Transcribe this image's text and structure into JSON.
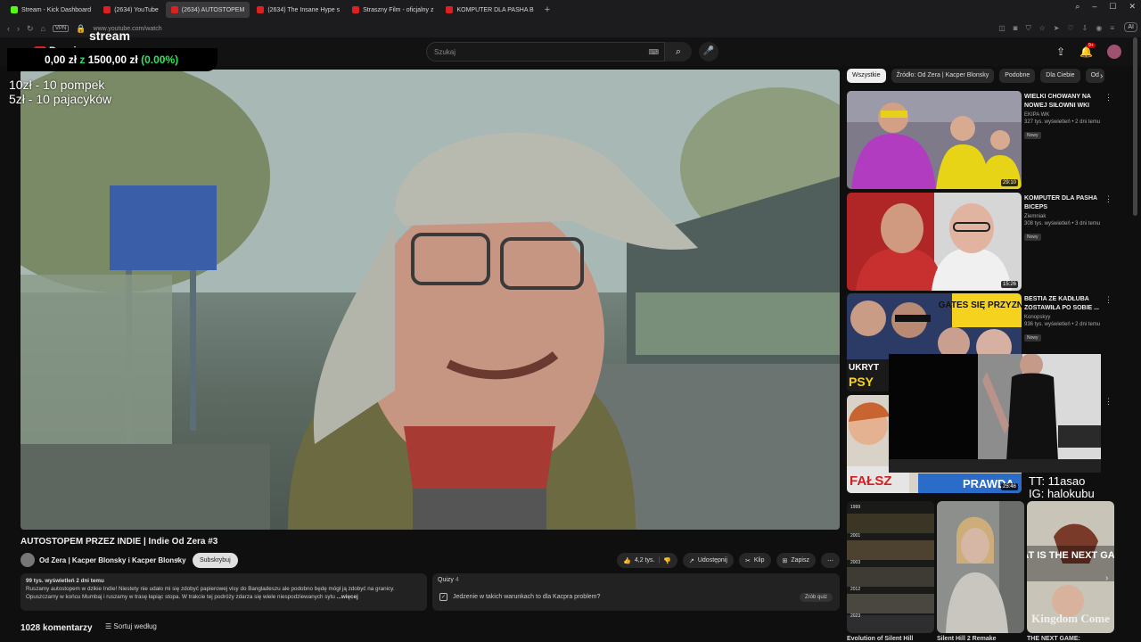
{
  "browser": {
    "tabs": [
      {
        "label": "Stream - Kick Dashboard",
        "color": "#53fc18"
      },
      {
        "label": "(2634) YouTube",
        "color": "#e02020"
      },
      {
        "label": "(2634) AUTOSTOPEM",
        "color": "#e02020"
      },
      {
        "label": "(2634) The Insane Hype s",
        "color": "#e02020"
      },
      {
        "label": "Straszny Film - oficjalny z",
        "color": "#e02020"
      },
      {
        "label": "KOMPUTER DLA PASHA B",
        "color": "#e02020"
      }
    ],
    "new_tab": "+",
    "url": "www.youtube.com/watch",
    "vpn": "VPN",
    "ai_label": "AI"
  },
  "yt": {
    "logo_text": "Premium",
    "logo_sup": "PL",
    "search_placeholder": "Szukaj",
    "notif_count": "9+"
  },
  "overlay": {
    "stream_label": "stream",
    "donation_amount": "0,00 zł",
    "donation_sep": "z",
    "donation_goal": "1500,00 zł",
    "donation_pct": "(0.00%)",
    "rule1": "10zł - 10 pompek",
    "rule2": "5zł - 10 pajacyków",
    "tiktok": "TT: 11asao",
    "instagram": "IG: halokubu",
    "accent_green": "#31e35c"
  },
  "video": {
    "title": "AUTOSTOPEM PRZEZ INDIE | Indie Od Zera #3",
    "channel": "Od Zera | Kacper Blonsky i Kacper Blonsky",
    "subscribe": "Subskrybuj",
    "likes": "4,2 tys.",
    "share": "Udostępnij",
    "clip": "Klip",
    "save": "Zapisz",
    "more": "⋯",
    "desc_meta": "99 tys. wyświetleń  2 dni temu",
    "desc_text": "Ruszamy autostopem w dzikie Indie! Niestety nie udało mi się zdobyć papierowej visy do Bangladeszu ale podobno będę mógł ją zdobyć na granicy. Opuszczamy w końcu Mumbaj i ruszamy w trasę łapiąc stopa. W trakcie tej podróży zdarza się wiele niespodziewanych sytu",
    "desc_more": "...więcej",
    "quiz_header": "Quizy",
    "quiz_count": "4",
    "quiz_question": "Jedzenie w takich warunkach to dla Kacpra problem?",
    "quiz_take": "Zrób quiz",
    "comments": "1028 komentarzy",
    "sort": "Sortuj według"
  },
  "chips": [
    "Wszystkie",
    "Źródło: Od Zera | Kacper Blonsky",
    "Podobne",
    "Dla Ciebie",
    "Od"
  ],
  "recs": [
    {
      "title": "WIELKI CHOWANY NA NOWEJ SIŁOWNI WKI",
      "channel": "EKIPA WK",
      "views": "327 tys. wyświetleń • 2 dni temu",
      "badge": "Nowy",
      "duration": "29:10"
    },
    {
      "title": "KOMPUTER DLA PASHA BICEPS",
      "channel": "Ziemniak",
      "views": "308 tys. wyświetleń • 3 dni temu",
      "badge": "Nowy",
      "duration": "15:26"
    },
    {
      "title": "BESTIA ZE KADŁUBA ZOSTAWIŁA PO SOBIE ...",
      "channel": "Konopskyy",
      "views": "936 tys. wyświetleń • 2 dni temu",
      "badge": "Nowy",
      "duration": ""
    },
    {
      "title": "",
      "channel": "",
      "views": "",
      "badge": "",
      "duration": "25:46"
    }
  ],
  "thumb_text": {
    "r3_gates": "GATES SIĘ PRZYZNAŁ",
    "r3_ukryty": "UKRYT",
    "r3_psy": "PSY",
    "r4_falsz": "FAŁSZ",
    "r4_prawda": "PRAWDA"
  },
  "shorts": [
    {
      "title": "Evolution of Silent Hill"
    },
    {
      "title": "Silent Hill 2 Remake"
    },
    {
      "title": "THE NEXT GAME:"
    }
  ],
  "shorts_text": {
    "s1_years": [
      "1999",
      "2001",
      "2003",
      "2012",
      "2023"
    ],
    "s3_overlay": "WHAT IS THE NEXT GAME?",
    "s3_bottom": "Kingdom Come"
  }
}
